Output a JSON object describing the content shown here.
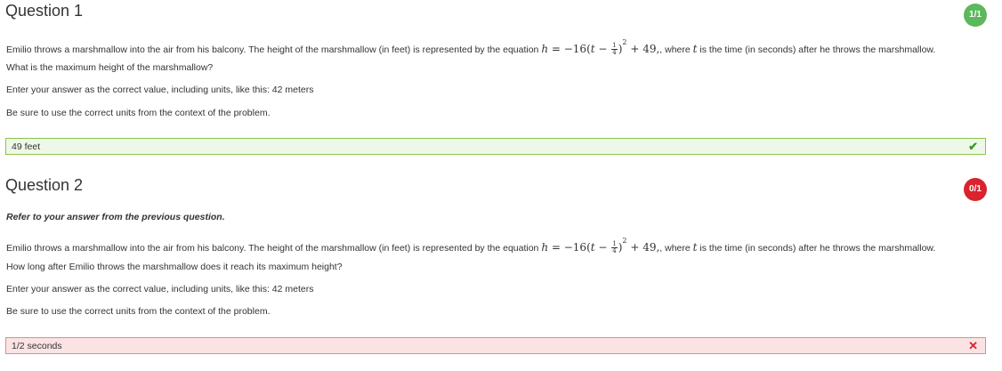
{
  "questions": [
    {
      "title": "Question 1",
      "score": "1/1",
      "score_color": "#5cb85c",
      "intro_before": "Emilio throws a marshmallow into the air from his balcony. The height of the marshmallow (in feet) is represented by the equation ",
      "intro_after": ", where ",
      "intro_var": "t",
      "intro_end": " is the time (in seconds) after he throws the marshmallow.",
      "equation": {
        "lhs": "h",
        "eq": " = −16",
        "open": "(",
        "t": "t",
        "minus": " − ",
        "num": "1",
        "den": "4",
        "close": ")",
        "exp": "2",
        "plus": " + 49,"
      },
      "prompt": "What is the maximum height of the marshmallow?",
      "instruction": "Enter your answer as the correct value, including units, like this: 42 meters",
      "units_note": "Be sure to use the correct units from the context of the problem.",
      "answer": "49 feet",
      "answer_status": "correct",
      "answer_icon": "✔",
      "answer_bg": "#eef8e8",
      "answer_border": "#8bc34a",
      "icon_color": "#3c9a29"
    },
    {
      "title": "Question 2",
      "score": "0/1",
      "score_color": "#d9232d",
      "refer": "Refer to your answer from the previous question.",
      "intro_before": "Emilio throws a marshmallow into the air from his balcony. The height of the marshmallow (in feet) is represented by the equation ",
      "intro_after": ", where ",
      "intro_var": "t",
      "intro_end": " is the time (in seconds) after he throws the marshmallow.",
      "equation": {
        "lhs": "h",
        "eq": " = −16",
        "open": "(",
        "t": "t",
        "minus": " − ",
        "num": "1",
        "den": "4",
        "close": ")",
        "exp": "2",
        "plus": " + 49,"
      },
      "prompt": "How long after Emilio throws the marshmallow does it reach its maximum height?",
      "instruction": "Enter your answer as the correct value, including units, like this: 42 meters",
      "units_note": "Be sure to use the correct units from the context of the problem.",
      "answer": "1/2 seconds",
      "answer_status": "incorrect",
      "answer_icon": "✕",
      "answer_bg": "#fbe3e4",
      "answer_border": "#e58a8f",
      "icon_color": "#d9232d"
    }
  ]
}
